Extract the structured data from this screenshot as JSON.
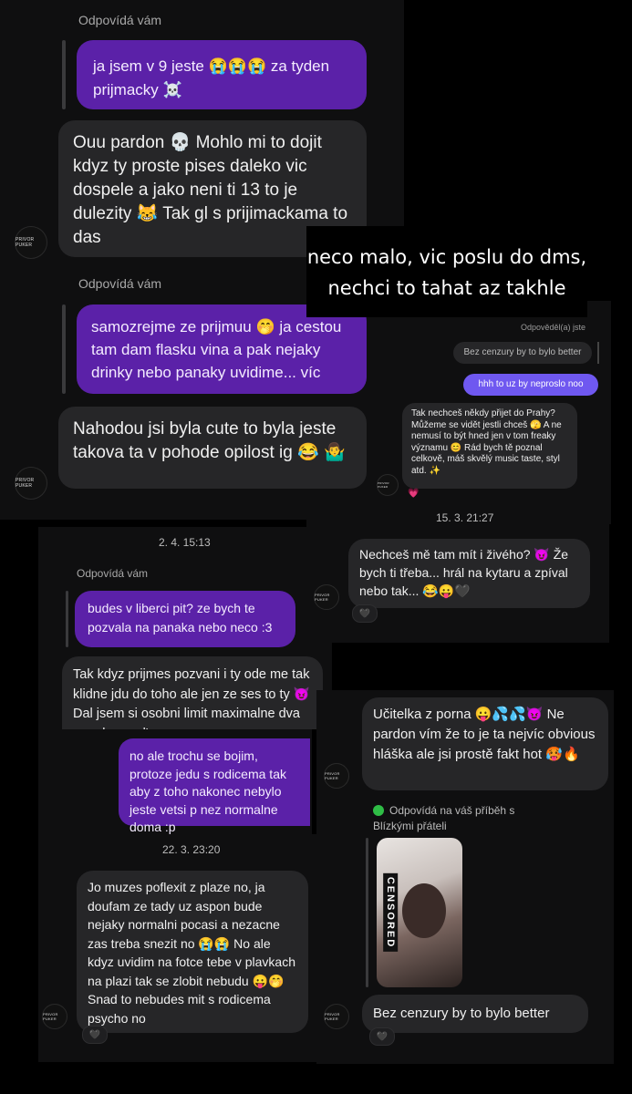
{
  "left_top": {
    "reply1_label": "Odpovídá vám",
    "purple1": "ja jsem v 9 jeste 😭😭😭 za tyden prijmacky ☠️",
    "gray1": "Ouu pardon 💀 Mohlo mi to dojit kdyz ty proste pises daleko vic dospele a jako neni ti 13 to je dulezity 😹 Tak gl s prijimackama to das",
    "reply2_label": "Odpovídá vám",
    "purple2": "samozrejme ze prijmuu 🤭 ja cestou tam dam flasku vina a pak nejaky drinky nebo panaky uvidime... víc",
    "gray2": "Nahodou jsi byla cute to byla jeste takova ta v pohode opilost ig 😂 🤷‍♂️",
    "avatar_text": "PRIVOR PUKER"
  },
  "overlay": {
    "line1": "neco malo, vic poslu do dms,",
    "line2": "nechci to tahat az takhle"
  },
  "right_small": {
    "reply_label": "Odpověděl(a) jste",
    "quoted": "Bez cenzury by to bylo better",
    "sent": "hhh to uz by neproslo noo",
    "received": "Tak nechceš někdy přijet do Prahy? Můžeme se vidět jestli chceš 🫣 A ne nemusí to být hned jen v tom freaky významu 😊 Rád bych tě poznal celkově, máš skvělý music taste, styl atd. ✨",
    "reaction": "💗"
  },
  "mid_left": {
    "time": "2. 4. 15:13",
    "reply_label": "Odpovídá vám",
    "purple": "budes v liberci pit? ze bych te pozvala na panaka nebo neco :3",
    "gray": "Tak kdyz prijmes pozvani i ty ode me tak klidne jdu do toho ale jen ze ses to ty 😈 Dal jsem si osobni limit maximalne dva panaky pred'",
    "purple_right": "no ale trochu se bojim, protoze jedu s rodicema tak aby z toho nakonec nebylo jeste vetsi p nez normalne doma :p"
  },
  "mid_right": {
    "time": "15. 3. 21:27",
    "gray1": "Nechceš mě tam mít i živého? 😈 Že bych ti třeba... hrál na kytaru a zpíval nebo tak... 😂😛🖤",
    "reaction1": "🖤",
    "gray2": "Učitelka z porna 😛💦💦😈 Ne pardon vím že to je ta nejvíc obvious hláška ale jsi prostě fakt hot 🥵🔥",
    "story_reply_line1": "Odpovídá na váš příběh s",
    "story_reply_line2": "Blízkými přáteli",
    "censored": "CENSORED",
    "gray3": "Bez cenzury by to bylo better",
    "reaction2": "🖤"
  },
  "bottom_left": {
    "time": "22. 3. 23:20",
    "gray": "Jo muzes poflexit z plaze no, ja doufam ze tady uz aspon bude nejaky normalni pocasi a nezacne zas treba snezit no 😭😭 No ale kdyz uvidim na fotce tebe v plavkach na plazi tak se zlobit nebudu 😛🤭 Snad to nebudes mit s rodicema psycho no",
    "reaction": "🖤"
  }
}
